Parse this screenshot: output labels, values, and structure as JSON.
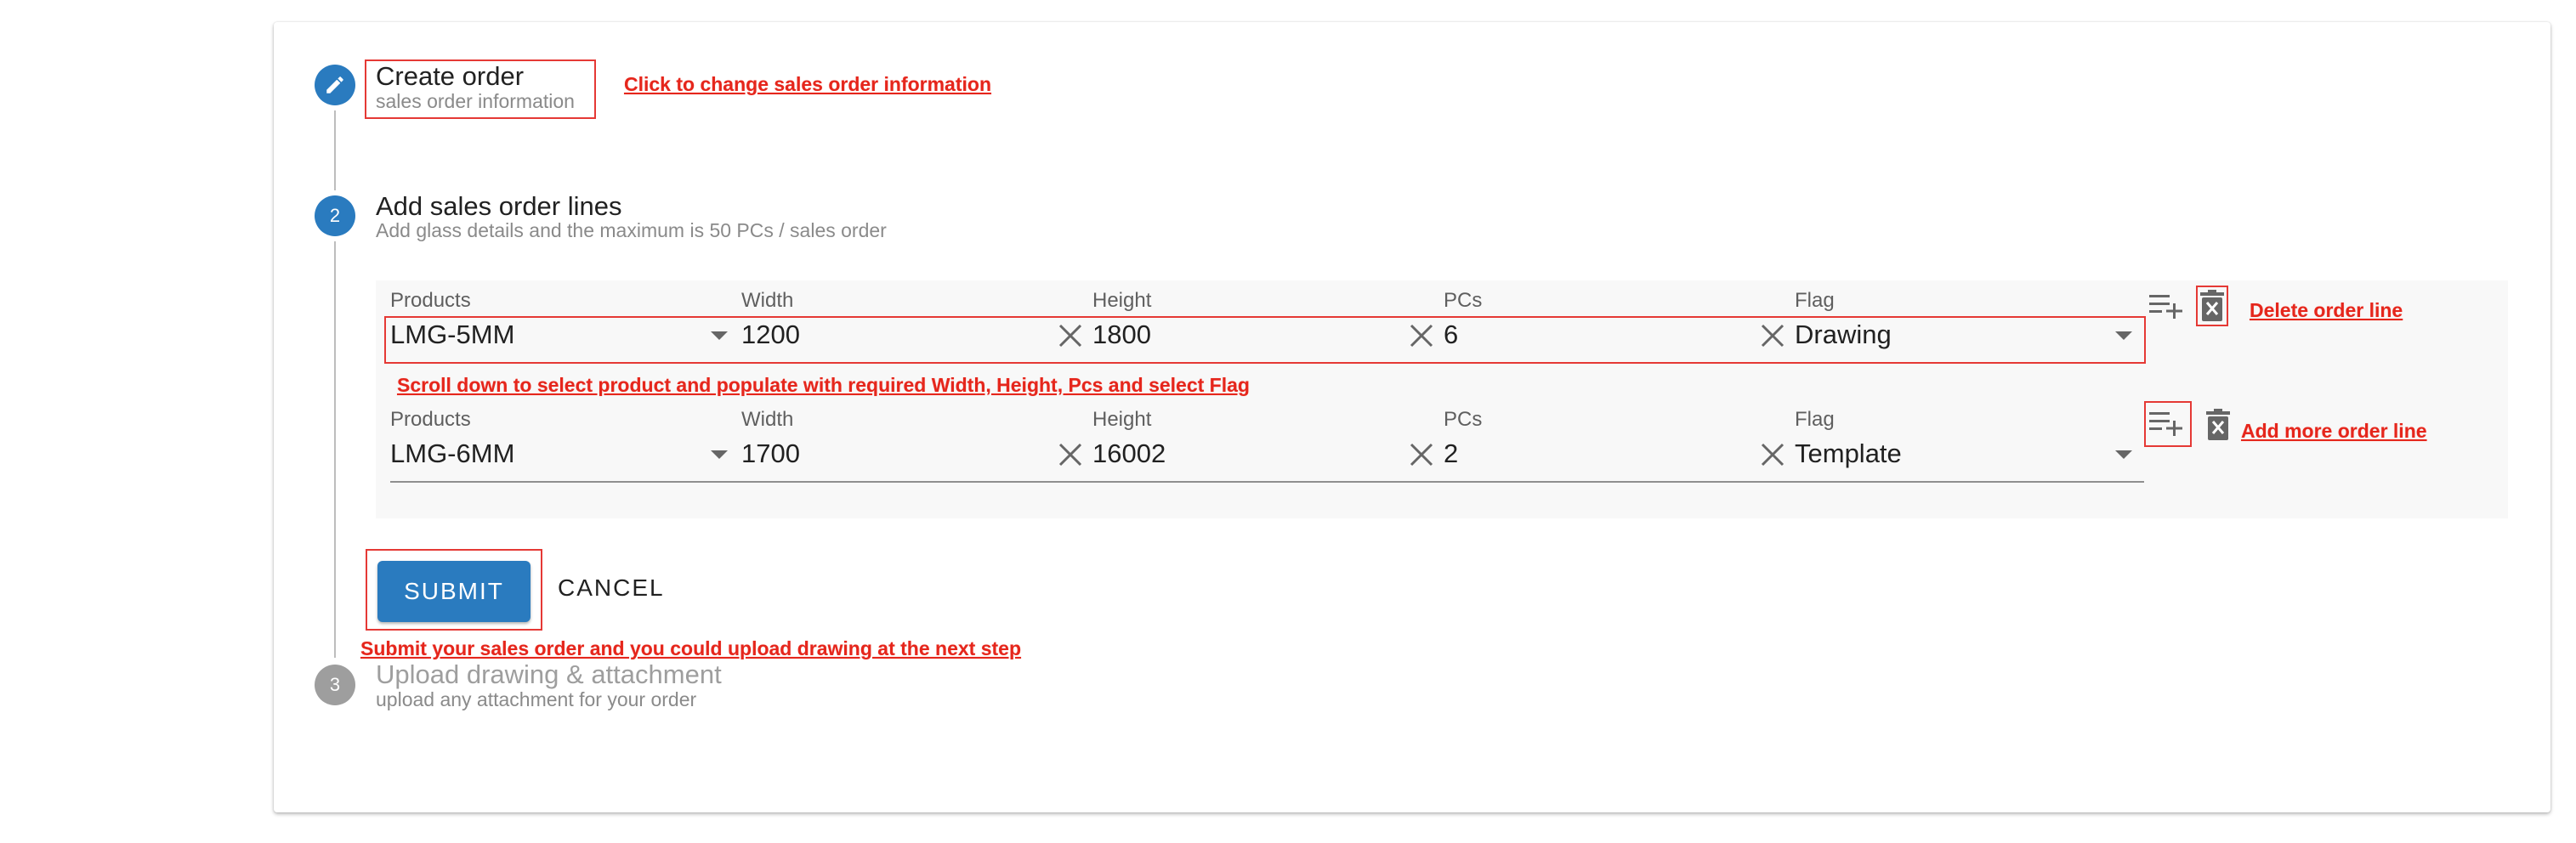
{
  "steps": [
    {
      "marker": "",
      "title": "Create order",
      "subtitle": "sales order information"
    },
    {
      "marker": "2",
      "title": "Add sales order lines",
      "subtitle": "Add glass details and the maximum is 50 PCs / sales order"
    },
    {
      "marker": "3",
      "title": "Upload drawing & attachment",
      "subtitle": "upload any attachment for your order"
    }
  ],
  "columns": [
    "Products",
    "Width",
    "Height",
    "PCs",
    "Flag"
  ],
  "order_lines": [
    {
      "product": "LMG-5MM",
      "width": "1200",
      "height": "1800",
      "pcs": "6",
      "flag": "Drawing"
    },
    {
      "product": "LMG-6MM",
      "width": "1700",
      "height": "16002",
      "pcs": "2",
      "flag": "Template"
    }
  ],
  "actions": {
    "submit": "SUBMIT",
    "cancel": "CANCEL"
  },
  "annotations": {
    "create_order": "Click to change sales order information",
    "delete_line": "Delete order line",
    "scroll_hint": "Scroll down to select product and populate with required Width, Height, Pcs and select Flag",
    "add_line": "Add more order line",
    "submit_hint": "Submit your sales order and you could upload drawing at the next step"
  },
  "colors": {
    "accent": "#2a7bbf",
    "annotation": "#e53935",
    "inactive": "#9e9e9e"
  },
  "icons": {
    "step1": "pencil-icon",
    "add_line": "playlist-add-icon",
    "delete_line": "delete-icon",
    "clear": "close-icon",
    "dropdown": "caret-down-icon"
  }
}
